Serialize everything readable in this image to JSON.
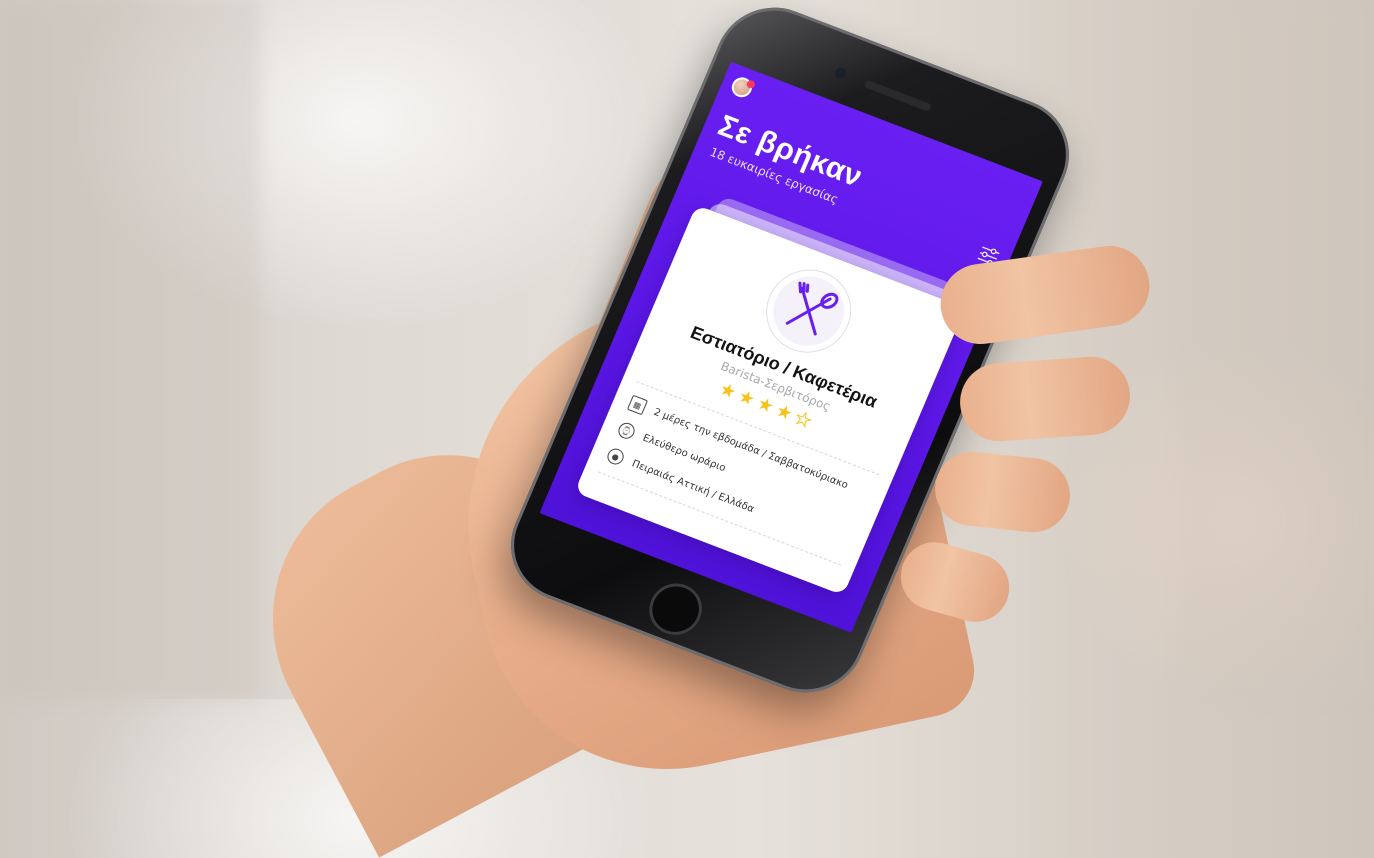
{
  "app": {
    "title": "Σε βρήκαν",
    "subtitle": "18 ευκαιρίες εργασίας"
  },
  "card": {
    "title": "Εστιατόριο / Καφετέρια",
    "role": "Barista-Σερβιτόρος",
    "rating": 4,
    "rating_max": 5,
    "details": [
      {
        "icon": "calendar-icon",
        "text": "2 μέρες την εβδομάδα / Σαββατοκύριακο"
      },
      {
        "icon": "clock-icon",
        "text": "Ελεύθερο ωράριο"
      },
      {
        "icon": "location-pin-icon",
        "text": "Πειραιάς Αττική / Ελλάδα"
      }
    ]
  },
  "actions": {
    "reject_icon": "close-icon",
    "jobs_icon": "briefcase-icon",
    "accept_icon": "check-icon"
  },
  "colors": {
    "primary": "#5a16e4",
    "reject": "#ff3b5c",
    "accept": "#2bb24c",
    "star": "#f7c21a",
    "badge": "#ff3b5c"
  }
}
